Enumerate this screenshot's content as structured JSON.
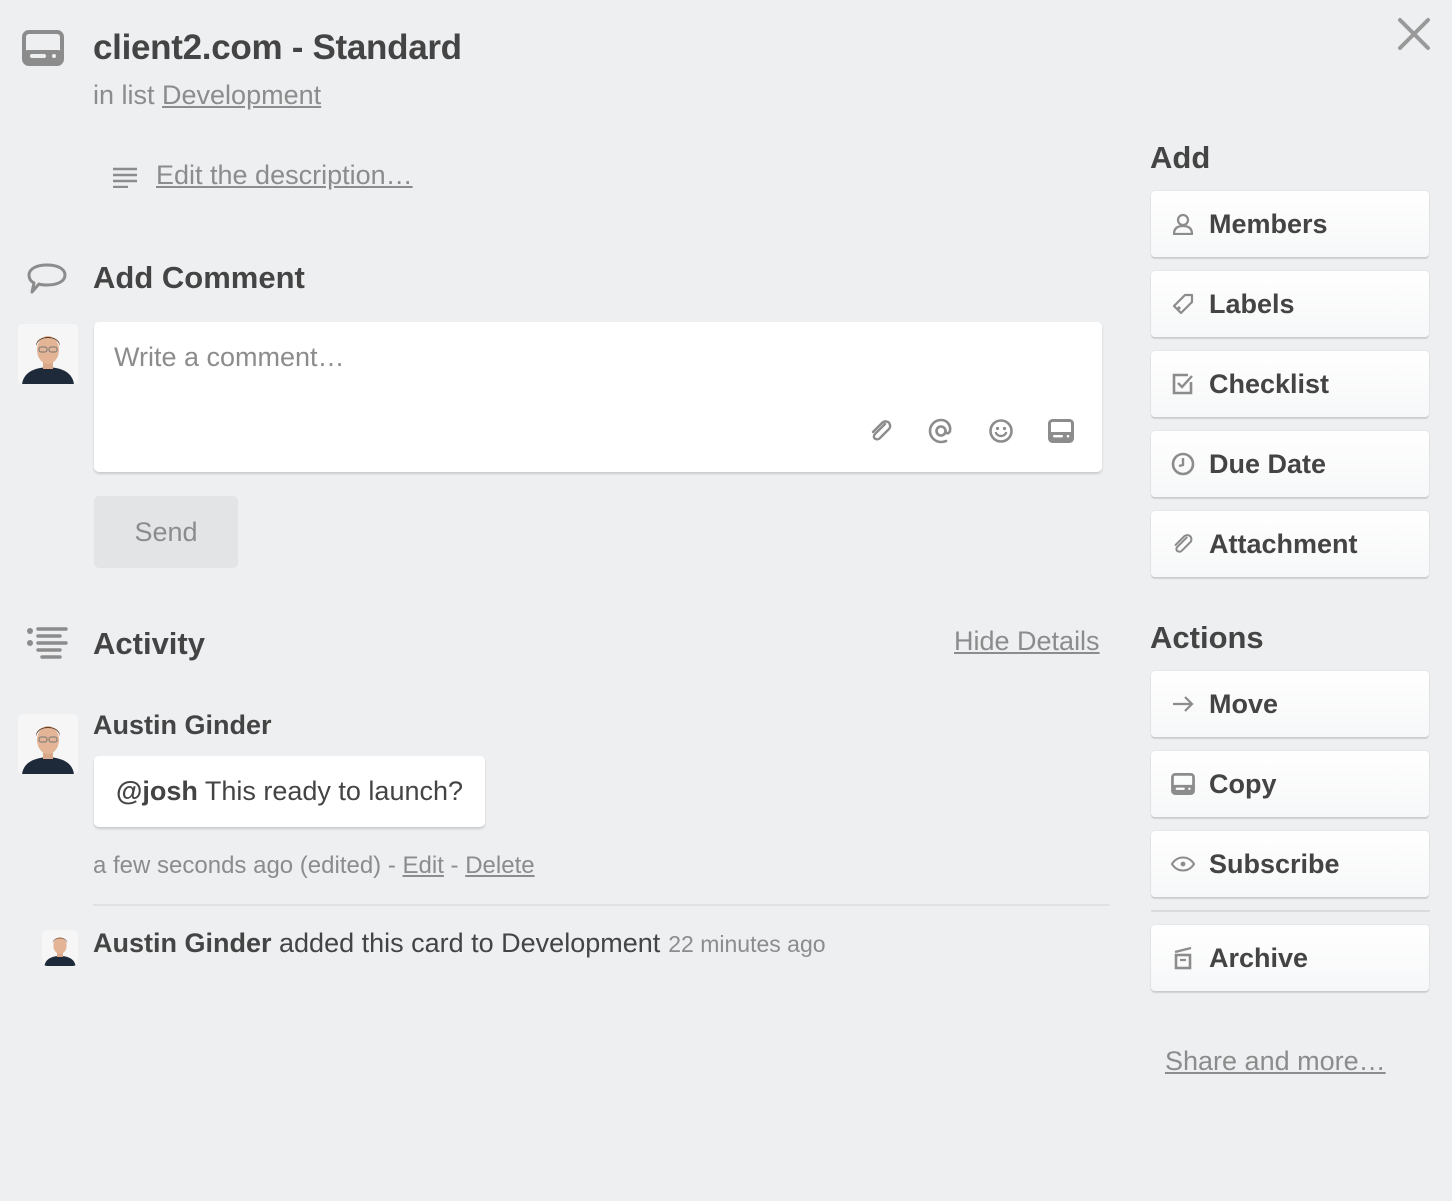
{
  "card": {
    "icon": "card-icon",
    "title": "client2.com - Standard",
    "list_prefix": "in list",
    "list_name": "Development",
    "close_icon": "close-icon"
  },
  "description": {
    "icon": "description-icon",
    "link_label": "Edit the description…"
  },
  "add_comment": {
    "icon": "comment-icon",
    "title": "Add Comment",
    "placeholder": "Write a comment…",
    "tools": [
      "attachment-icon",
      "mention-icon",
      "emoji-icon",
      "card-icon"
    ],
    "send_label": "Send"
  },
  "activity": {
    "icon": "activity-icon",
    "title": "Activity",
    "hide_details_label": "Hide Details",
    "comment": {
      "author": "Austin Ginder",
      "mention": "@josh",
      "text": " This ready to launch?",
      "meta": "a few seconds ago (edited) - ",
      "edit_label": "Edit",
      "separator": " - ",
      "delete_label": "Delete"
    },
    "event": {
      "author": "Austin Ginder",
      "text": " added this card to Development",
      "time": "22 minutes ago"
    }
  },
  "sidebar": {
    "add_title": "Add",
    "add_items": [
      {
        "icon": "member-icon",
        "label": "Members"
      },
      {
        "icon": "label-icon",
        "label": "Labels"
      },
      {
        "icon": "checklist-icon",
        "label": "Checklist"
      },
      {
        "icon": "clock-icon",
        "label": "Due Date"
      },
      {
        "icon": "attachment-icon",
        "label": "Attachment"
      }
    ],
    "actions_title": "Actions",
    "action_items": [
      {
        "icon": "arrow-right-icon",
        "label": "Move"
      },
      {
        "icon": "card-icon",
        "label": "Copy"
      },
      {
        "icon": "eye-icon",
        "label": "Subscribe"
      },
      {
        "icon": "archive-icon",
        "label": "Archive"
      }
    ],
    "share_label": "Share and more…"
  }
}
